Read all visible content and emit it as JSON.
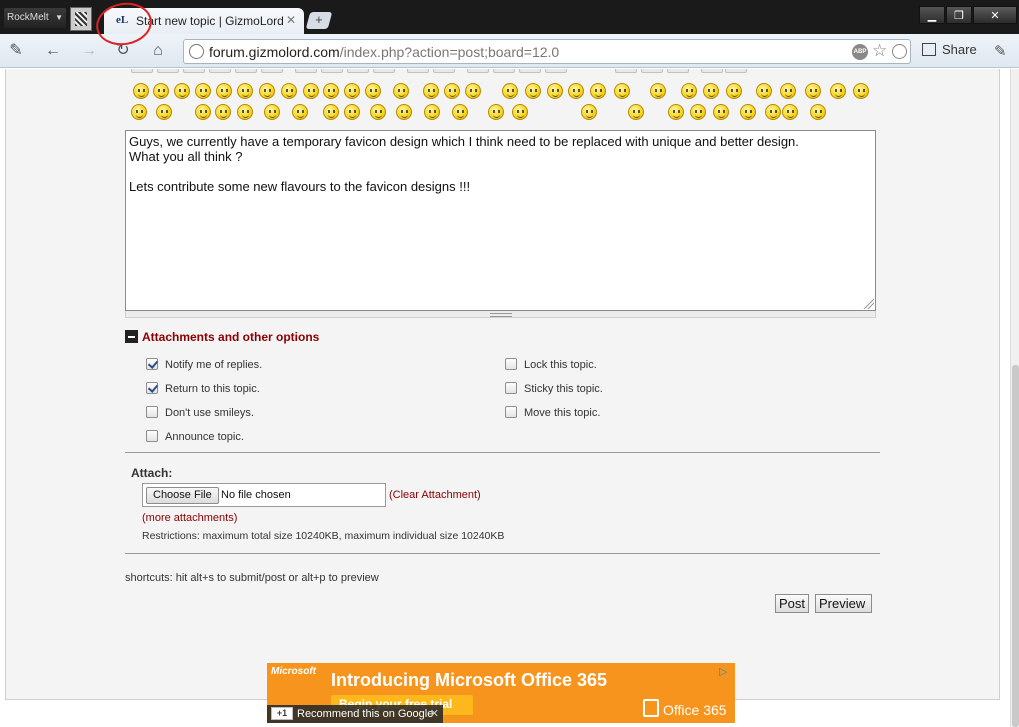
{
  "browser": {
    "profile_button": "RockMelt",
    "tab_title": "Start new topic | GizmoLord",
    "tab_favicon_text": "eL",
    "new_tab_symbol": "+",
    "url_host": "forum.gizmolord.com",
    "url_path": "/index.php?action=post;board=12.0",
    "share_label": "Share",
    "adblock_badge": "ABP"
  },
  "message": {
    "lines": [
      "Guys, we currently have a temporary favicon design which I think need to be replaced with unique and better design.",
      "What you all think ?",
      "",
      "Lets contribute some new flavours to the favicon designs !!!"
    ]
  },
  "attachments": {
    "section_title": "Attachments and other options",
    "options_left": [
      {
        "label": "Notify me of replies.",
        "checked": true
      },
      {
        "label": "Return to this topic.",
        "checked": true
      },
      {
        "label": "Don't use smileys.",
        "checked": false
      },
      {
        "label": "Announce topic.",
        "checked": false
      }
    ],
    "options_right": [
      {
        "label": "Lock this topic.",
        "checked": false
      },
      {
        "label": "Sticky this topic.",
        "checked": false
      },
      {
        "label": "Move this topic.",
        "checked": false
      }
    ],
    "attach_label": "Attach:",
    "choose_file": "Choose File",
    "no_file": "No file chosen",
    "clear_attachment": "(Clear Attachment)",
    "more_attachments": "(more attachments)",
    "restrictions": "Restrictions: maximum total size 10240KB, maximum individual size 10240KB"
  },
  "footer": {
    "shortcuts": "shortcuts: hit alt+s to submit/post or alt+p to preview",
    "post": "Post",
    "preview": "Preview"
  },
  "ad": {
    "brand": "Microsoft",
    "headline": "Introducing Microsoft Office 365",
    "cta": "Begin your free trial",
    "product": "Office 365",
    "recommend": "Recommend this on Google",
    "plus_one": "+1"
  }
}
